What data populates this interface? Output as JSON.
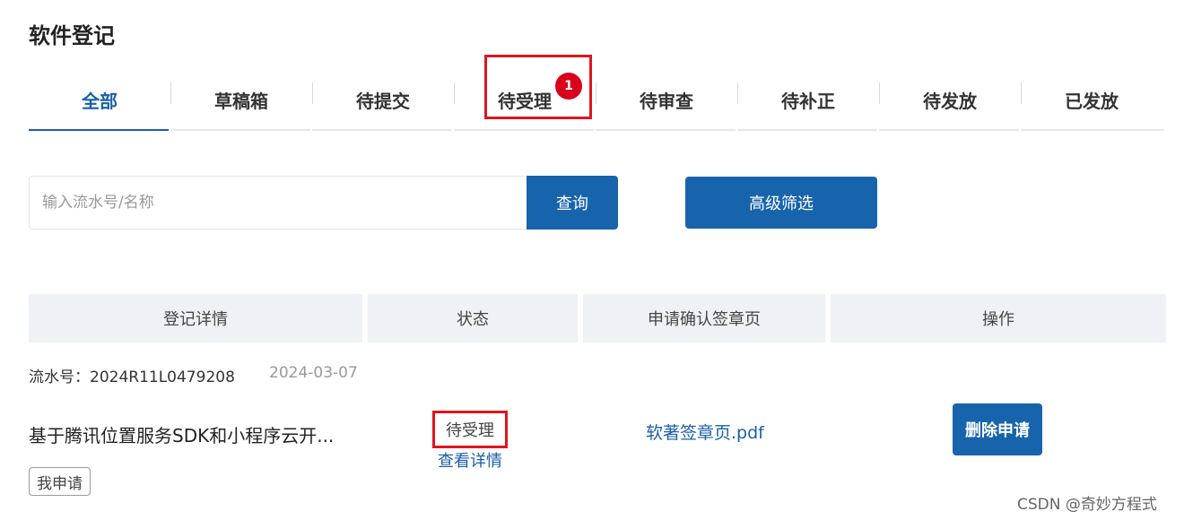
{
  "page": {
    "title": "软件登记"
  },
  "tabs": [
    {
      "label": "全部",
      "active": true
    },
    {
      "label": "草稿箱"
    },
    {
      "label": "待提交"
    },
    {
      "label": "待受理",
      "badge": "1"
    },
    {
      "label": "待审查"
    },
    {
      "label": "待补正"
    },
    {
      "label": "待发放"
    },
    {
      "label": "已发放"
    }
  ],
  "search": {
    "placeholder": "输入流水号/名称",
    "button_label": "查询",
    "advanced_label": "高级筛选"
  },
  "table": {
    "headers": [
      "登记详情",
      "状态",
      "申请确认签章页",
      "操作"
    ]
  },
  "record": {
    "serial": "流水号：2024R11L0479208",
    "date": "2024-03-07",
    "name": "基于腾讯位置服务SDK和小程序云开...",
    "tag": "我申请",
    "status": "待受理",
    "detail_link": "查看详情",
    "file_link": "软著签章页.pdf",
    "action_label": "删除申请"
  },
  "watermark": "CSDN @奇妙方程式",
  "colors": {
    "primary": "#1764ad",
    "highlight": "#e0141e",
    "badge": "#d9001b"
  }
}
